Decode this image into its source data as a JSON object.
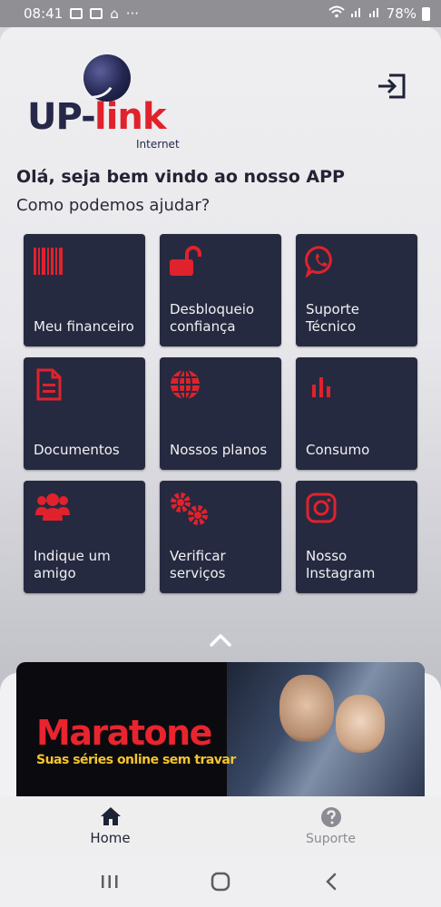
{
  "status_bar": {
    "time": "08:41",
    "dots": "···",
    "battery_text": "78%"
  },
  "header": {
    "logo": {
      "brand_up": "UP-",
      "brand_link": "link",
      "brand_sub": "Internet"
    },
    "logout_icon": "logout-icon"
  },
  "greeting": {
    "title": "Olá, seja bem vindo ao nosso APP",
    "subtitle": "Como podemos ajudar?"
  },
  "menu": {
    "items": [
      {
        "label": "Meu financeiro",
        "icon": "barcode-icon"
      },
      {
        "label": "Desbloqueio confiança",
        "icon": "unlock-icon"
      },
      {
        "label": "Suporte Técnico",
        "icon": "whatsapp-icon"
      },
      {
        "label": "Documentos",
        "icon": "document-icon"
      },
      {
        "label": "Nossos planos",
        "icon": "globe-icon"
      },
      {
        "label": "Consumo",
        "icon": "bar-chart-icon"
      },
      {
        "label": "Indique um amigo",
        "icon": "users-icon"
      },
      {
        "label": "Verificar serviços",
        "icon": "gears-icon"
      },
      {
        "label": "Nosso Instagram",
        "icon": "instagram-icon"
      }
    ]
  },
  "banner": {
    "title": "Maratone",
    "subtitle": "Suas séries online sem travar"
  },
  "bottom_nav": {
    "home_label": "Home",
    "support_label": "Suporte"
  },
  "colors": {
    "tile_bg": "#262a40",
    "accent_red": "#e0222c",
    "navy": "#252849"
  }
}
